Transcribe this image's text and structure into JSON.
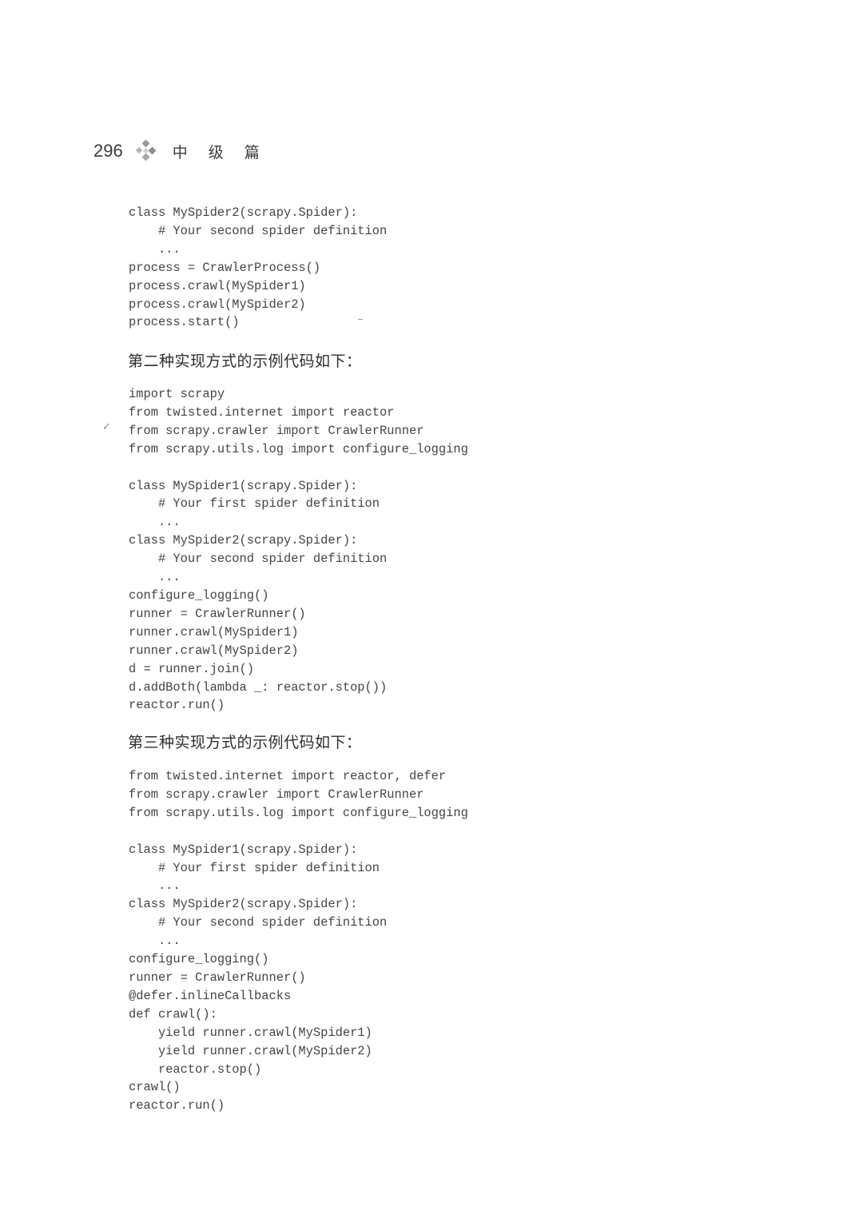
{
  "header": {
    "page_number": "296",
    "ornament_icon": "diamond-cluster-icon",
    "section": "中 级 篇"
  },
  "code_block_1": "class MySpider2(scrapy.Spider):\n    # Your second spider definition\n    ...\nprocess = CrawlerProcess()\nprocess.crawl(MySpider1)\nprocess.crawl(MySpider2)\nprocess.start()",
  "caption_2": "第二种实现方式的示例代码如下：",
  "code_block_2": "import scrapy\nfrom twisted.internet import reactor\nfrom scrapy.crawler import CrawlerRunner\nfrom scrapy.utils.log import configure_logging\n\nclass MySpider1(scrapy.Spider):\n    # Your first spider definition\n    ...\nclass MySpider2(scrapy.Spider):\n    # Your second spider definition\n    ...\nconfigure_logging()\nrunner = CrawlerRunner()\nrunner.crawl(MySpider1)\nrunner.crawl(MySpider2)\nd = runner.join()\nd.addBoth(lambda _: reactor.stop())\nreactor.run()",
  "caption_3": "第三种实现方式的示例代码如下：",
  "code_block_3": "from twisted.internet import reactor, defer\nfrom scrapy.crawler import CrawlerRunner\nfrom scrapy.utils.log import configure_logging\n\nclass MySpider1(scrapy.Spider):\n    # Your first spider definition\n    ...\nclass MySpider2(scrapy.Spider):\n    # Your second spider definition\n    ...\nconfigure_logging()\nrunner = CrawlerRunner()\n@defer.inlineCallbacks\ndef crawl():\n    yield runner.crawl(MySpider1)\n    yield runner.crawl(MySpider2)\n    reactor.stop()\ncrawl()\nreactor.run()",
  "annotation": {
    "check_mark": "✓"
  }
}
